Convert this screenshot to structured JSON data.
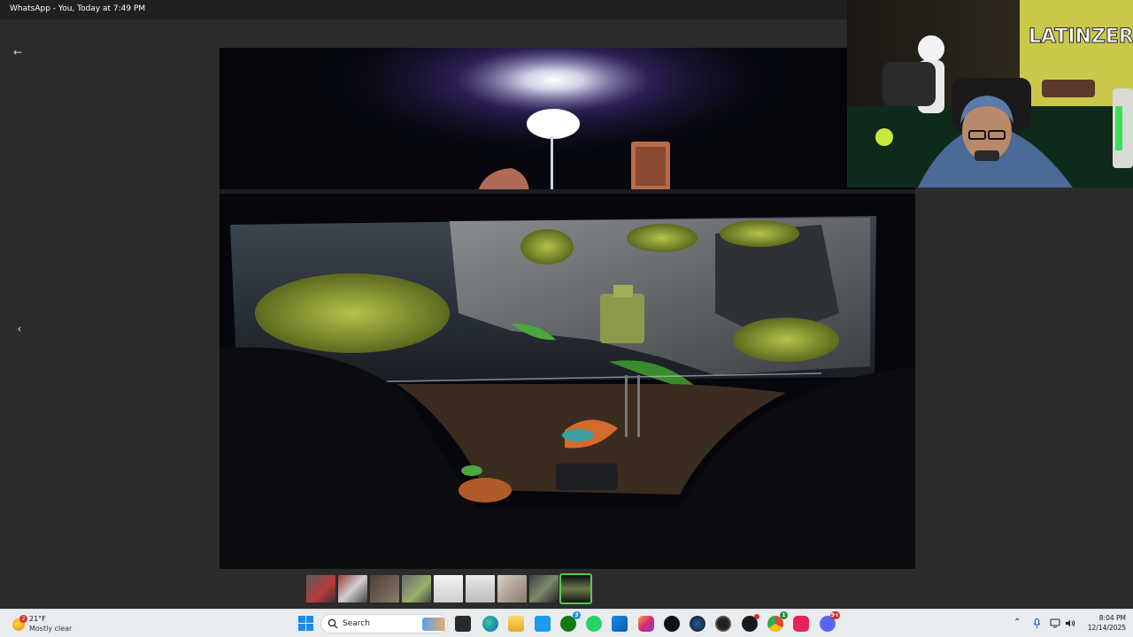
{
  "window": {
    "title": "WhatsApp - You, Today at 7:49 PM"
  },
  "viewer": {
    "back_icon": "back-arrow-icon",
    "back_glyph": "←",
    "prev_icon": "chevron-left-icon",
    "prev_glyph": "‹",
    "photo_subject": "aquarium-paludarium-photo",
    "webcam_overlay": "streamer-webcam",
    "webcam_sign_text": "LATINZERO"
  },
  "filmstrip": {
    "thumbnail_count": 9,
    "active_index": 8
  },
  "taskbar": {
    "weather": {
      "badge": "2",
      "temperature": "21°F",
      "condition": "Mostly clear"
    },
    "search": {
      "placeholder": "Search"
    },
    "apps": [
      {
        "name": "task-view",
        "badge": ""
      },
      {
        "name": "edge",
        "badge": ""
      },
      {
        "name": "file-explorer",
        "badge": ""
      },
      {
        "name": "twitter",
        "badge": ""
      },
      {
        "name": "xbox",
        "badge": "3"
      },
      {
        "name": "whatsapp",
        "badge": ""
      },
      {
        "name": "microsoft-store",
        "badge": ""
      },
      {
        "name": "instagram",
        "badge": ""
      },
      {
        "name": "tiktok",
        "badge": ""
      },
      {
        "name": "steam",
        "badge": ""
      },
      {
        "name": "obs",
        "badge": ""
      },
      {
        "name": "app-red-dot",
        "badge": ""
      },
      {
        "name": "chrome",
        "badge": "1"
      },
      {
        "name": "tiktok-live",
        "badge": ""
      },
      {
        "name": "discord",
        "badge": "9+"
      }
    ],
    "tray": {
      "clock_time": "8:04 PM",
      "clock_date": "12/14/2025"
    }
  },
  "colors": {
    "accent": "#1a8ce6",
    "active_thumb_outline": "#5ac85a",
    "viewer_bg": "#2b2b2b",
    "taskbar_bg": "#e9ecef"
  }
}
